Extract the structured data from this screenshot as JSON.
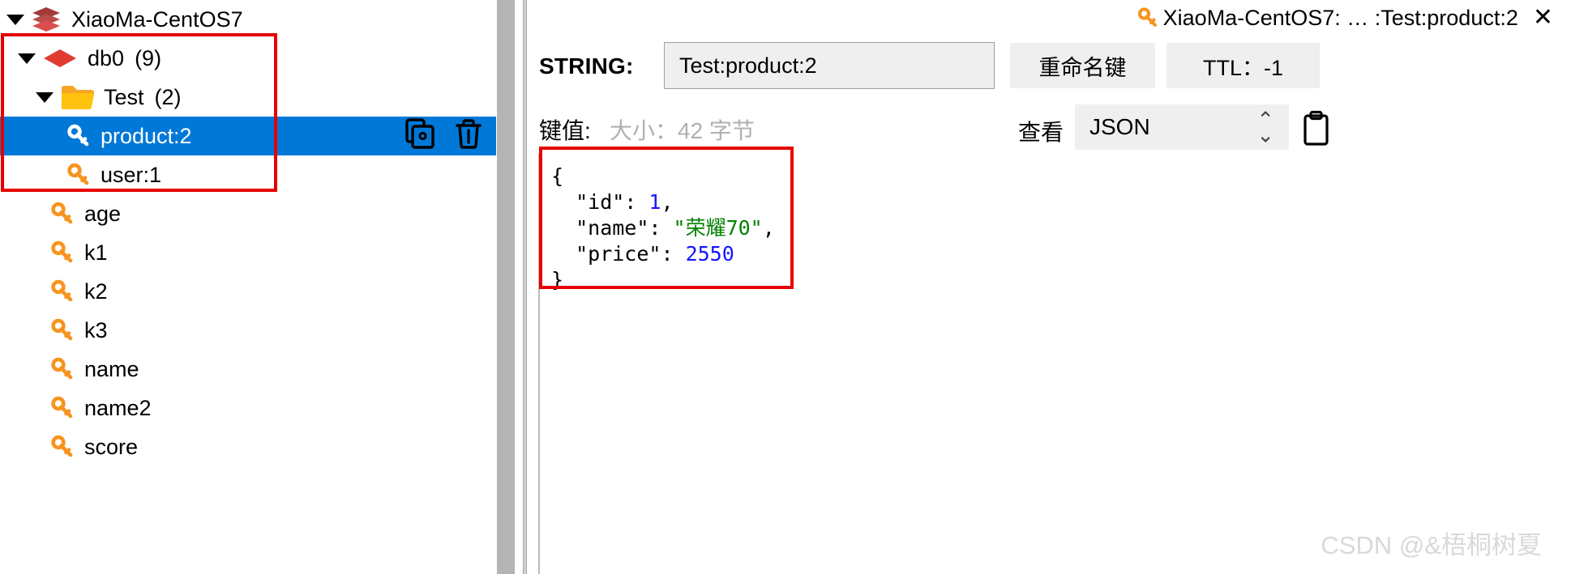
{
  "tree": {
    "server": {
      "label": "XiaoMa-CentOS7",
      "icon": "stack-icon",
      "expanded": true
    },
    "database": {
      "label": "db0",
      "count": "(9)",
      "icon": "database-icon",
      "expanded": true
    },
    "folder": {
      "label": "Test",
      "count": "(2)",
      "icon": "folder-icon",
      "expanded": true
    },
    "keys": [
      {
        "label": "product:2",
        "icon": "key-icon",
        "selected": true,
        "indent": 3
      },
      {
        "label": "user:1",
        "icon": "key-icon",
        "selected": false,
        "indent": 3
      },
      {
        "label": "age",
        "icon": "key-icon",
        "selected": false,
        "indent": 2
      },
      {
        "label": "k1",
        "icon": "key-icon",
        "selected": false,
        "indent": 2
      },
      {
        "label": "k2",
        "icon": "key-icon",
        "selected": false,
        "indent": 2
      },
      {
        "label": "k3",
        "icon": "key-icon",
        "selected": false,
        "indent": 2
      },
      {
        "label": "name",
        "icon": "key-icon",
        "selected": false,
        "indent": 2
      },
      {
        "label": "name2",
        "icon": "key-icon",
        "selected": false,
        "indent": 2
      },
      {
        "label": "score",
        "icon": "key-icon",
        "selected": false,
        "indent": 2
      }
    ],
    "row_actions": {
      "duplicate": "copy-key-icon",
      "delete": "trash-icon"
    },
    "annotation_color": "#e60000"
  },
  "detail": {
    "tab": {
      "icon": "key-icon",
      "title": "XiaoMa-CentOS7: … :Test:product:2",
      "close": "✕"
    },
    "type_label": "STRING:",
    "key_name": "Test:product:2",
    "rename_button": "重命名键",
    "ttl_button": "TTL：-1",
    "value_label": "键值:",
    "size_label": "大小：42 字节",
    "view_label": "查看",
    "view_format": "JSON",
    "spinner_up": "⌃",
    "spinner_down": "⌄",
    "copy_icon": "clipboard-icon",
    "json": {
      "open_brace": "{",
      "close_brace": "}",
      "lines": [
        {
          "key": "\"id\"",
          "value": "1",
          "kind": "num",
          "comma": ","
        },
        {
          "key": "\"name\"",
          "value": "\"荣耀70\"",
          "kind": "str",
          "comma": ","
        },
        {
          "key": "\"price\"",
          "value": "2550",
          "kind": "num",
          "comma": ""
        }
      ]
    }
  },
  "watermark": "CSDN @&梧桐树夏",
  "colors": {
    "selection_blue": "#0078d7",
    "key_icon_orange": "#f7941e",
    "folder_yellow": "#ffc20e",
    "db_red": "#e03c31",
    "annotation_red": "#e60000",
    "json_number": "#1414ff",
    "json_string": "#008000"
  }
}
